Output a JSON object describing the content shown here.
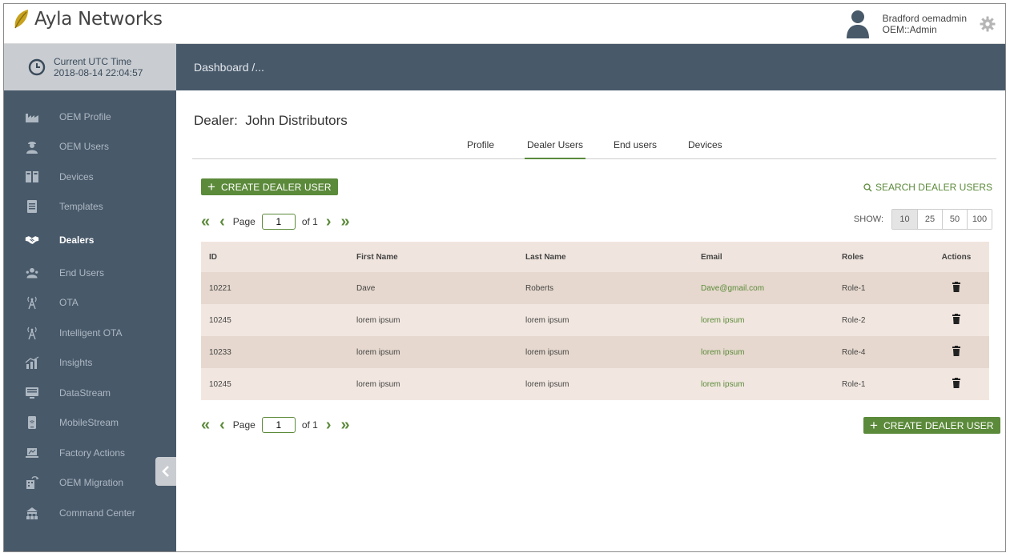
{
  "header": {
    "brand": "Ayla Networks",
    "user_name": "Bradford oemadmin",
    "user_role": "OEM::Admin",
    "icons": {
      "logo": "leaf-icon",
      "avatar": "user-icon",
      "settings": "gear-icon"
    }
  },
  "utc": {
    "label": "Current UTC Time",
    "value": "2018-08-14 22:04:57"
  },
  "breadcrumb": "Dashboard /...",
  "sidebar": {
    "items": [
      {
        "label": "OEM Profile",
        "icon": "factory-icon"
      },
      {
        "label": "OEM Users",
        "icon": "worker-icon"
      },
      {
        "label": "Devices",
        "icon": "devices-icon"
      },
      {
        "label": "Templates",
        "icon": "document-icon"
      },
      {
        "label": "Dealers",
        "icon": "handshake-icon",
        "active": true
      },
      {
        "label": "End Users",
        "icon": "users-icon"
      },
      {
        "label": "OTA",
        "icon": "antenna-icon"
      },
      {
        "label": "Intelligent OTA",
        "icon": "antenna-icon"
      },
      {
        "label": "Insights",
        "icon": "chart-icon"
      },
      {
        "label": "DataStream",
        "icon": "monitor-icon"
      },
      {
        "label": "MobileStream",
        "icon": "mobile-icon"
      },
      {
        "label": "Factory Actions",
        "icon": "laptop-icon"
      },
      {
        "label": "OEM Migration",
        "icon": "migration-icon"
      },
      {
        "label": "Command Center",
        "icon": "network-icon"
      }
    ]
  },
  "page": {
    "title": "Dealer:  John Distributors",
    "tabs": [
      "Profile",
      "Dealer Users",
      "End users",
      "Devices"
    ],
    "active_tab": "Dealer Users",
    "create_button": "CREATE DEALER USER",
    "search_link": "SEARCH DEALER USERS",
    "pager": {
      "label": "Page",
      "current": "1",
      "of": "of 1"
    },
    "show": {
      "label": "SHOW:",
      "options": [
        "10",
        "25",
        "50",
        "100"
      ],
      "selected": "10"
    }
  },
  "table": {
    "columns": [
      "ID",
      "First Name",
      "Last Name",
      "Email",
      "Roles",
      "Actions"
    ],
    "rows": [
      {
        "id": "10221",
        "first": "Dave",
        "last": "Roberts",
        "email": "Dave@gmail.com",
        "role": "Role-1"
      },
      {
        "id": "10245",
        "first": "lorem ipsum",
        "last": "lorem ipsum",
        "email": "lorem ipsum",
        "role": "Role-2"
      },
      {
        "id": "10233",
        "first": "lorem ipsum",
        "last": "lorem ipsum",
        "email": "lorem ipsum",
        "role": "Role-4"
      },
      {
        "id": "10245",
        "first": "lorem ipsum",
        "last": "lorem ipsum",
        "email": "lorem ipsum",
        "role": "Role-1"
      }
    ],
    "action_icon": "trash-icon"
  },
  "colors": {
    "accent": "#5b8a3a",
    "sidebar": "#48596a",
    "row_dark": "#e6d8ce",
    "row_light": "#f2e7e0"
  }
}
